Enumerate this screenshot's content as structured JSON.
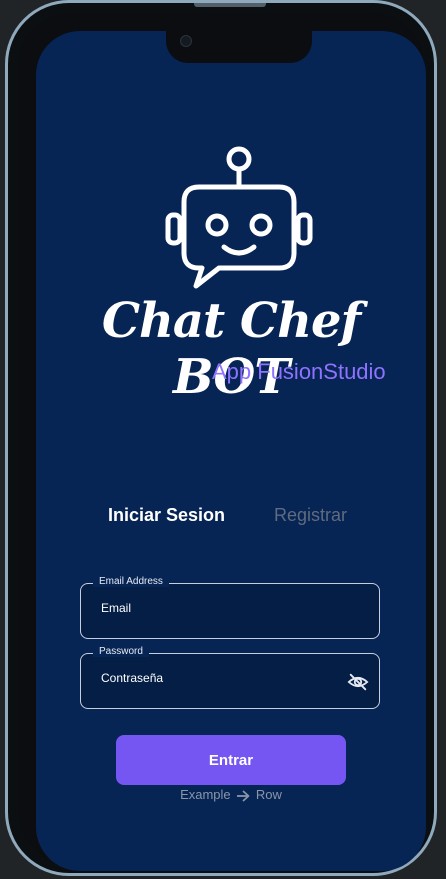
{
  "app": {
    "title": "Chat Chef BOT",
    "subtitle": "App FusionStudio"
  },
  "tabs": {
    "login": "Iniciar Sesion",
    "register": "Registrar"
  },
  "form": {
    "email": {
      "label": "Email Address",
      "placeholder": "Email"
    },
    "password": {
      "label": "Password",
      "placeholder": "Contraseña"
    },
    "submit_label": "Entrar"
  },
  "footer": {
    "left": "Example",
    "right": "Row",
    "icon": "arrow-right-icon"
  },
  "colors": {
    "background": "#062454",
    "accent": "#7556f2",
    "subtitle": "#8f72ff",
    "inactive_tab": "#5f6b7f"
  },
  "icons": {
    "logo": "robot-chat-bubble-icon",
    "password_toggle": "eye-off-icon"
  }
}
